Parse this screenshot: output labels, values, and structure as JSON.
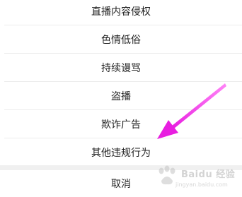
{
  "report_menu": {
    "items": [
      {
        "label": "直播内容侵权"
      },
      {
        "label": "色情低俗"
      },
      {
        "label": "持续谩骂"
      },
      {
        "label": "盗播"
      },
      {
        "label": "欺诈广告"
      },
      {
        "label": "其他违规行为"
      }
    ],
    "cancel_label": "取消"
  },
  "annotation": {
    "arrow_color": "#e81ee0"
  },
  "watermark": {
    "brand": "Baidu 经验",
    "domain": "jingyan.baidu.com"
  }
}
